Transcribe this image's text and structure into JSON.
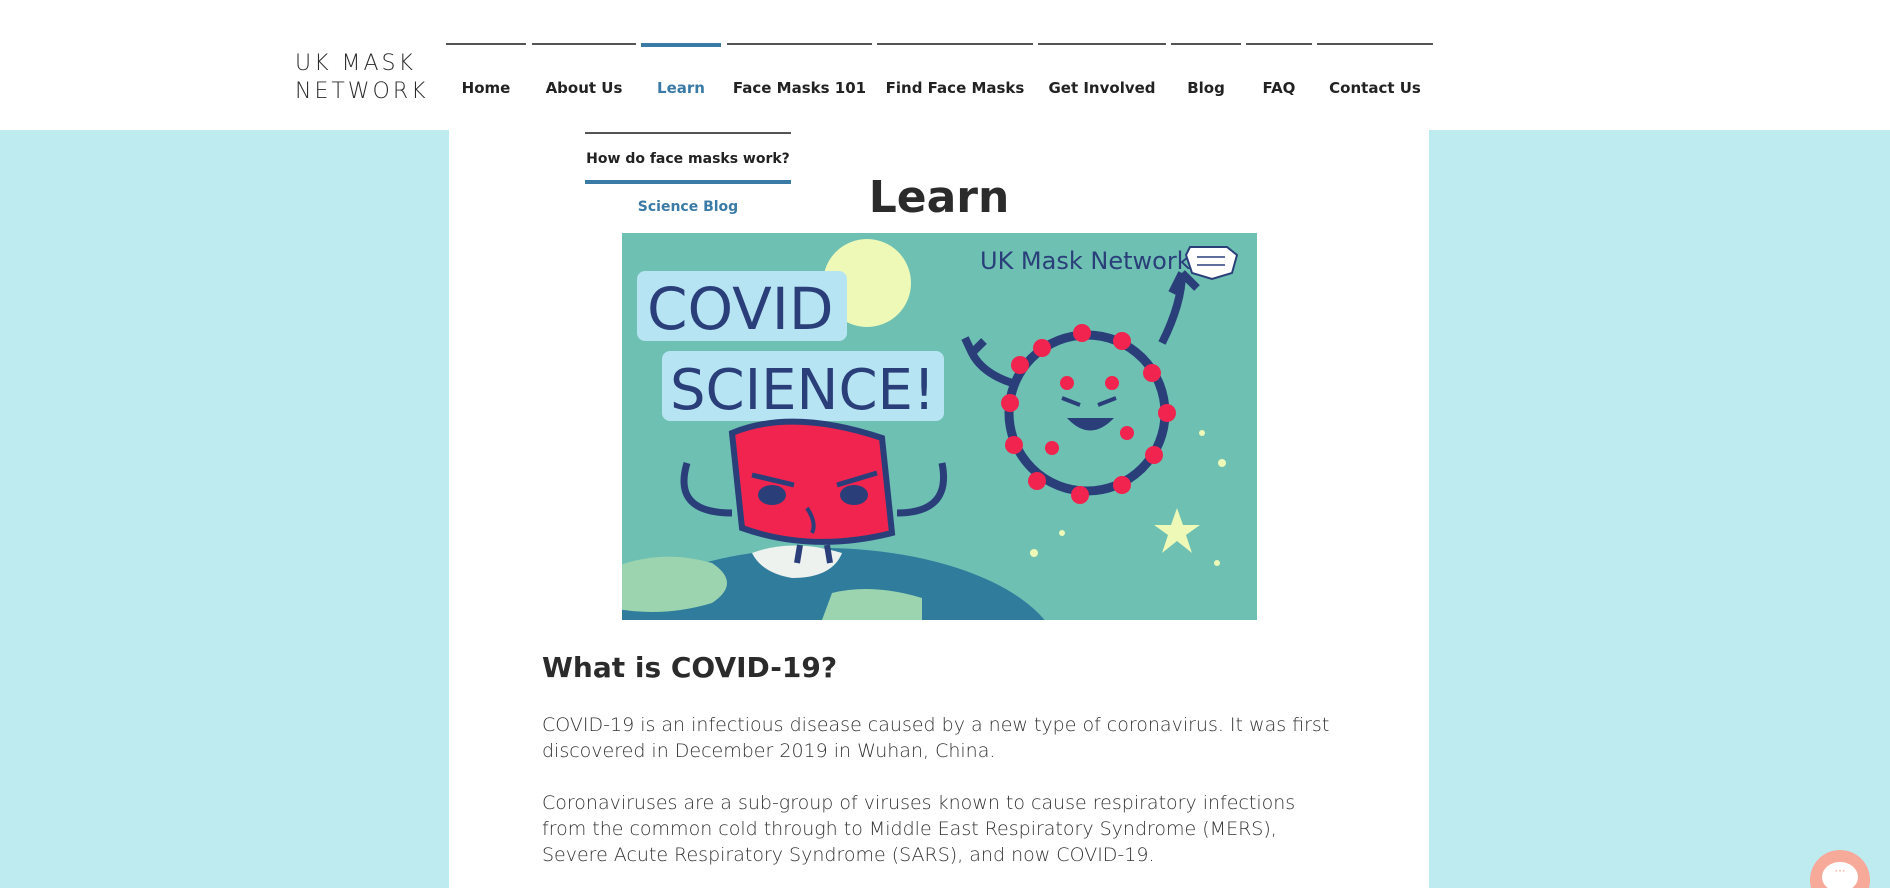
{
  "header": {
    "logo_line1": "UK MASK",
    "logo_line2": "NETWORK"
  },
  "nav": {
    "items": [
      {
        "label": "Home"
      },
      {
        "label": "About Us"
      },
      {
        "label": "Learn",
        "active": true
      },
      {
        "label": "Face Masks 101"
      },
      {
        "label": "Find Face Masks"
      },
      {
        "label": "Get Involved"
      },
      {
        "label": "Blog"
      },
      {
        "label": "FAQ"
      },
      {
        "label": "Contact Us"
      }
    ],
    "active_color": "#3a7aa6"
  },
  "dropdown": {
    "items": [
      {
        "label": "How do face masks work?"
      },
      {
        "label": "Science Blog"
      }
    ]
  },
  "page": {
    "title": "Learn"
  },
  "hero": {
    "brand_text": "UK Mask Network",
    "headline_line1": "COVID",
    "headline_line2": "SCIENCE!",
    "background_color": "#6dc0b2"
  },
  "article": {
    "heading": "What is COVID-19?",
    "paragraphs": [
      "COVID-19 is an infectious disease caused by a new type of coronavirus. It was first discovered in December 2019 in Wuhan, China.",
      "Coronaviruses are a sub-group of viruses known to cause respiratory infections from the common cold through to Middle East Respiratory Syndrome (MERS), Severe Acute Respiratory Syndrome (SARS), and now COVID-19."
    ]
  },
  "chat": {
    "icon": "chat-icon",
    "glyph": "···"
  },
  "colors": {
    "page_background": "#bdebf0",
    "panel": "#ffffff",
    "text": "#2b2b2b"
  }
}
